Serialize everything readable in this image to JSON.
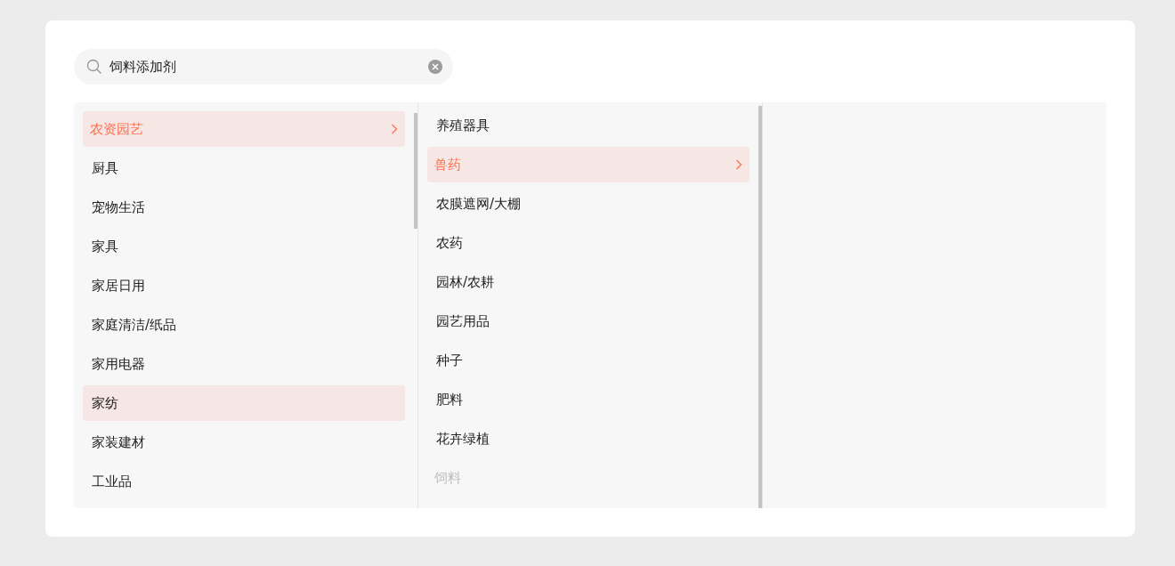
{
  "search": {
    "value": "饲料添加剂"
  },
  "columns": [
    {
      "items": [
        {
          "label": "农资园艺",
          "selected": true,
          "highlighted": false,
          "disabled": false
        },
        {
          "label": "厨具",
          "selected": false,
          "highlighted": false,
          "disabled": false
        },
        {
          "label": "宠物生活",
          "selected": false,
          "highlighted": false,
          "disabled": false
        },
        {
          "label": "家具",
          "selected": false,
          "highlighted": false,
          "disabled": false
        },
        {
          "label": "家居日用",
          "selected": false,
          "highlighted": false,
          "disabled": false
        },
        {
          "label": "家庭清洁/纸品",
          "selected": false,
          "highlighted": false,
          "disabled": false
        },
        {
          "label": "家用电器",
          "selected": false,
          "highlighted": false,
          "disabled": false
        },
        {
          "label": "家纺",
          "selected": false,
          "highlighted": true,
          "disabled": false
        },
        {
          "label": "家装建材",
          "selected": false,
          "highlighted": false,
          "disabled": false
        },
        {
          "label": "工业品",
          "selected": false,
          "highlighted": false,
          "disabled": false
        }
      ]
    },
    {
      "items": [
        {
          "label": "养殖器具",
          "selected": false,
          "highlighted": false,
          "disabled": false
        },
        {
          "label": "兽药",
          "selected": true,
          "highlighted": false,
          "disabled": false
        },
        {
          "label": "农膜遮网/大棚",
          "selected": false,
          "highlighted": false,
          "disabled": false
        },
        {
          "label": "农药",
          "selected": false,
          "highlighted": false,
          "disabled": false
        },
        {
          "label": "园林/农耕",
          "selected": false,
          "highlighted": false,
          "disabled": false
        },
        {
          "label": "园艺用品",
          "selected": false,
          "highlighted": false,
          "disabled": false
        },
        {
          "label": "种子",
          "selected": false,
          "highlighted": false,
          "disabled": false
        },
        {
          "label": "肥料",
          "selected": false,
          "highlighted": false,
          "disabled": false
        },
        {
          "label": "花卉绿植",
          "selected": false,
          "highlighted": false,
          "disabled": false
        },
        {
          "label": "饲料",
          "selected": false,
          "highlighted": false,
          "disabled": true
        }
      ]
    }
  ]
}
